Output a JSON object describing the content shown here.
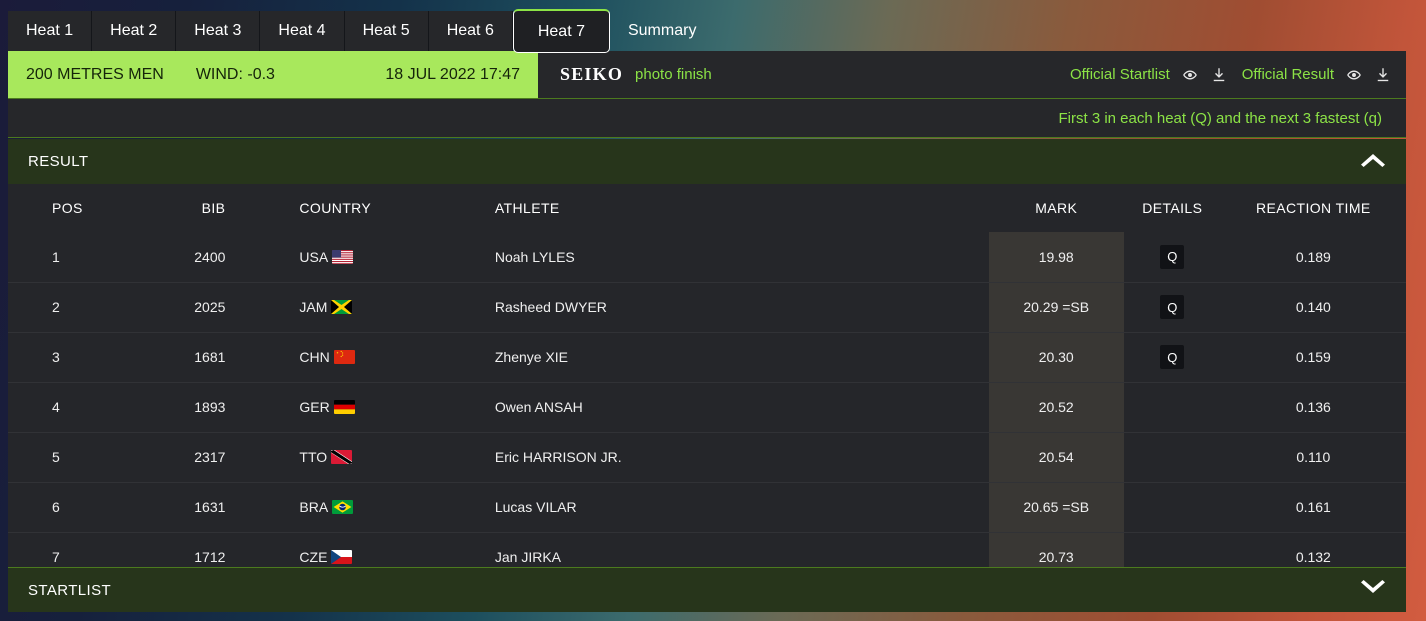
{
  "tabs": [
    {
      "label": "Heat 1",
      "active": false
    },
    {
      "label": "Heat 2",
      "active": false
    },
    {
      "label": "Heat 3",
      "active": false
    },
    {
      "label": "Heat 4",
      "active": false
    },
    {
      "label": "Heat 5",
      "active": false
    },
    {
      "label": "Heat 6",
      "active": false
    },
    {
      "label": "Heat 7",
      "active": true
    },
    {
      "label": "Summary",
      "active": false
    }
  ],
  "event": {
    "name": "200 METRES MEN",
    "wind": "WIND: -0.3",
    "datetime": "18 JUL 2022 17:47",
    "timing_brand": "SEIKO",
    "timing_service": "photo finish",
    "official_startlist_label": "Official Startlist",
    "official_result_label": "Official Result",
    "qualification_note": "First 3 in each heat (Q) and the next 3 fastest (q)"
  },
  "sections": {
    "result_title": "RESULT",
    "startlist_title": "STARTLIST"
  },
  "columns": {
    "pos": "POS",
    "bib": "BIB",
    "country": "COUNTRY",
    "athlete": "ATHLETE",
    "mark": "MARK",
    "details": "DETAILS",
    "reaction_time": "REACTION TIME"
  },
  "colors": {
    "accent_green": "#8ce346",
    "banner_green": "#a8e85c",
    "section_green": "#27351b",
    "panel_dark": "#25262a",
    "mark_cell": "#393734"
  },
  "rows": [
    {
      "pos": "1",
      "bib": "2400",
      "country": "USA",
      "flag": "us-flag",
      "athlete": "Noah LYLES",
      "mark": "19.98",
      "details": "Q",
      "reaction_time": "0.189"
    },
    {
      "pos": "2",
      "bib": "2025",
      "country": "JAM",
      "flag": "jm-flag",
      "athlete": "Rasheed DWYER",
      "mark": "20.29 =SB",
      "details": "Q",
      "reaction_time": "0.140"
    },
    {
      "pos": "3",
      "bib": "1681",
      "country": "CHN",
      "flag": "cn-flag",
      "athlete": "Zhenye XIE",
      "mark": "20.30",
      "details": "Q",
      "reaction_time": "0.159"
    },
    {
      "pos": "4",
      "bib": "1893",
      "country": "GER",
      "flag": "de-flag",
      "athlete": "Owen ANSAH",
      "mark": "20.52",
      "details": "",
      "reaction_time": "0.136"
    },
    {
      "pos": "5",
      "bib": "2317",
      "country": "TTO",
      "flag": "tt-flag",
      "athlete": "Eric HARRISON JR.",
      "mark": "20.54",
      "details": "",
      "reaction_time": "0.110"
    },
    {
      "pos": "6",
      "bib": "1631",
      "country": "BRA",
      "flag": "br-flag",
      "athlete": "Lucas VILAR",
      "mark": "20.65 =SB",
      "details": "",
      "reaction_time": "0.161"
    },
    {
      "pos": "7",
      "bib": "1712",
      "country": "CZE",
      "flag": "cz-flag",
      "athlete": "Jan JIRKA",
      "mark": "20.73",
      "details": "",
      "reaction_time": "0.132"
    }
  ]
}
